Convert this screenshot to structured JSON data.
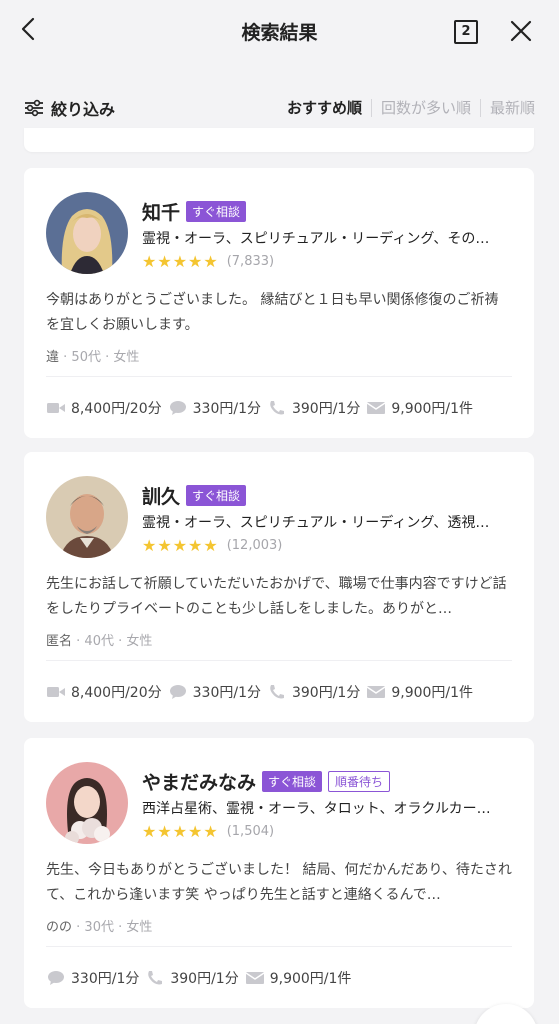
{
  "header": {
    "title": "検索結果",
    "tab_count": "2"
  },
  "filter": {
    "label": "絞り込み",
    "sorts": [
      {
        "label": "おすすめ順",
        "active": true
      },
      {
        "label": "回数が多い順",
        "active": false
      },
      {
        "label": "最新順",
        "active": false
      }
    ]
  },
  "advisors": [
    {
      "name": "知千",
      "badge_now": "すぐ相談",
      "genres": "霊視・オーラ、スピリチュアル・リーディング、その…",
      "stars": "★★★★★",
      "rating_count": "(7,833)",
      "review": "今朝はありがとうございました。 縁結びと１日も早い関係修復のご祈祷を宜しくお願いします。",
      "reviewer": "違",
      "reviewer_age": "50代",
      "reviewer_gender": "女性",
      "prices": {
        "video": "8,400円/20分",
        "chat": "330円/1分",
        "phone": "390円/1分",
        "mail": "9,900円/1件"
      }
    },
    {
      "name": "訓久",
      "badge_now": "すぐ相談",
      "genres": "霊視・オーラ、スピリチュアル・リーディング、透視…",
      "stars": "★★★★★",
      "rating_count": "(12,003)",
      "review": "先生にお話して祈願していただいたおかげで、職場で仕事内容ですけど話をしたりプライベートのことも少し話しをしました。ありがと…",
      "reviewer": "匿名",
      "reviewer_age": "40代",
      "reviewer_gender": "女性",
      "prices": {
        "video": "8,400円/20分",
        "chat": "330円/1分",
        "phone": "390円/1分",
        "mail": "9,900円/1件"
      }
    },
    {
      "name": "やまだみなみ",
      "badge_now": "すぐ相談",
      "badge_wait": "順番待ち",
      "genres": "西洋占星術、霊視・オーラ、タロット、オラクルカー…",
      "stars": "★★★★★",
      "rating_count": "(1,504)",
      "review": "先生、今日もありがとうございました！ 結局、何だかんだあり、待たされて、これから逢います笑 やっぱり先生と話すと連絡くるんで…",
      "reviewer": "のの",
      "reviewer_age": "30代",
      "reviewer_gender": "女性",
      "prices": {
        "chat": "330円/1分",
        "phone": "390円/1分",
        "mail": "9,900円/1件"
      }
    }
  ],
  "colors": {
    "accent": "#8b55d6",
    "star": "#f4c531",
    "background": "#f3f3f5"
  }
}
